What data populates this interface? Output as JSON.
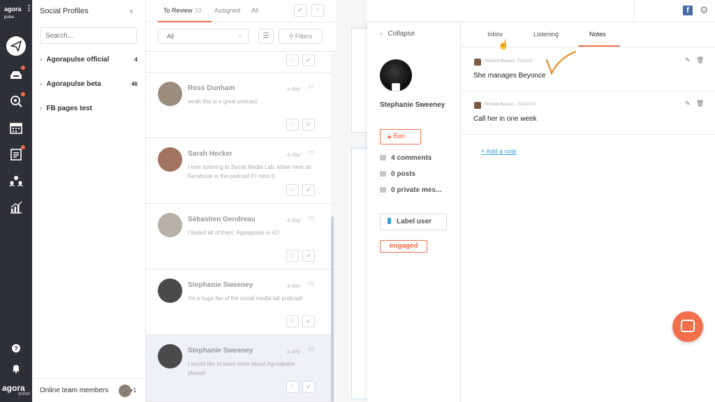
{
  "rail": {
    "logo_text": "agora",
    "logo_sub": "pulse",
    "bottom_logo": "agora",
    "bottom_logo_sub": "pulse",
    "icons": [
      "publish-icon",
      "inbox-icon",
      "listening-icon",
      "calendar-icon",
      "reports-list-icon",
      "team-icon",
      "analytics-icon",
      "help-icon",
      "notifications-icon"
    ]
  },
  "profiles": {
    "title": "Social Profiles",
    "search_placeholder": "Search...",
    "items": [
      {
        "label": "Agorapulse official",
        "count": "4"
      },
      {
        "label": "Agorapulse beta",
        "count": "46"
      },
      {
        "label": "FB pages test",
        "count": ""
      }
    ],
    "footer_label": "Online team members",
    "footer_extra": "+1"
  },
  "review": {
    "tabs": [
      {
        "label": "To Review",
        "count": "10"
      },
      {
        "label": "Assigned",
        "count": ""
      },
      {
        "label": "All",
        "count": ""
      }
    ],
    "filter_value": "All",
    "filters_label": "Filters",
    "messages": [
      {
        "name": "Ross Dunham",
        "time": "a day",
        "text": "woah this is a great podcast"
      },
      {
        "name": "Sarah Hecker",
        "time": "a day",
        "text": "I love listening to Social Media Lab, either here on Facebook or the podcast if I miss it."
      },
      {
        "name": "Sébastien Gendreau",
        "time": "a day",
        "text": "I tested all of them: Agorapulse is #1!"
      },
      {
        "name": "Stephanie Sweeney",
        "time": "a day",
        "text": "I'm a huge fan of the social media lab podcast!"
      },
      {
        "name": "Stephanie Sweeney",
        "time": "a day",
        "text": "I would like to learn more about Agorapulse please!"
      }
    ]
  },
  "user": {
    "collapse_label": "Collapse",
    "name": "Stephanie Sweeney",
    "ban_label": "Ban",
    "stats": [
      "4 comments",
      "0 posts",
      "0 private mes..."
    ],
    "label_button": "Label user",
    "tag": "engaged"
  },
  "notes": {
    "tabs": [
      "Inbox",
      "Listening",
      "Notes"
    ],
    "active_tab": "Notes",
    "items": [
      {
        "author_meta": "Richard Beeson, 7/16/201",
        "body": "She manages Beyonce"
      },
      {
        "author_meta": "Richard Beeson, 7/16/2019",
        "body": "Call her in one week"
      }
    ],
    "add_note_label": "+ Add a note"
  },
  "colors": {
    "accent": "#f26f4b",
    "rail_bg": "#2d3037",
    "link": "#3aa0d9",
    "facebook": "#4b6aa8"
  }
}
